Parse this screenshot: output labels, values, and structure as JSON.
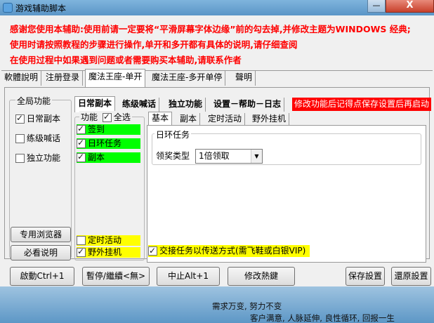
{
  "window": {
    "title": "游戏辅助脚本",
    "minimize_glyph": "—",
    "close_glyph": "X"
  },
  "notices": [
    "感谢您使用本辅助:使用前请一定要将“平滑屏幕字体边缘”前的勾去掉,并修改主题为WINDOWS 经典;",
    "使用时请按照教程的步骤进行操作,单开和多开都有具体的说明,请仔细查阅",
    "在使用过程中如果遇到问题或者需要购买本辅助,请联系作者"
  ],
  "top_tabs": [
    {
      "label": "軟體說明",
      "active": false
    },
    {
      "label": "注册登录",
      "active": false
    },
    {
      "label": "魔法王座-单开",
      "active": true
    },
    {
      "label": "魔法王座-多开单停",
      "active": false
    },
    {
      "label": "聲明",
      "active": false
    }
  ],
  "global_group": {
    "title": "全局功能",
    "items": [
      {
        "label": "日常副本",
        "checked": true
      },
      {
        "label": "练级喊话",
        "checked": false
      },
      {
        "label": "独立功能",
        "checked": false
      }
    ],
    "browser_button": "专用浏览器",
    "help_button": "必看说明"
  },
  "sub_tabs": [
    {
      "label": "日常副本",
      "active": true
    },
    {
      "label": "练级喊话",
      "active": false
    },
    {
      "label": "独立功能",
      "active": false
    },
    {
      "label": "设置－帮助－日志",
      "active": false
    }
  ],
  "red_banner": "修改功能后记得点保存设置后再启动",
  "func_group": {
    "title": "功能",
    "select_all_label": "全选",
    "select_all_checked": true,
    "items": [
      {
        "label": "签到",
        "checked": true,
        "color": "#00ff00"
      },
      {
        "label": "日环任务",
        "checked": true,
        "color": "#00ff00"
      },
      {
        "label": "副本",
        "checked": true,
        "color": "#00ff00"
      },
      {
        "label": "定时活动",
        "checked": false,
        "color": "#ffff00"
      },
      {
        "label": "野外挂机",
        "checked": true,
        "color": "#ffff00"
      }
    ]
  },
  "inner_tabs": [
    {
      "label": "基本",
      "active": true
    },
    {
      "label": "副本",
      "active": false
    },
    {
      "label": "定时活动",
      "active": false
    },
    {
      "label": "野外挂机",
      "active": false
    }
  ],
  "daily_ring": {
    "group_title": "日环任务",
    "reward_label": "领奖类型",
    "reward_value": "1倍领取"
  },
  "relay_option": {
    "label": "交接任务以传送方式(需飞鞋或白银VIP)",
    "checked": true
  },
  "bottom_buttons": {
    "start": "啟動Ctrl+1",
    "pause": "暫停/繼續<無>",
    "stop": "中止Alt+1",
    "hotkey": "修改熱鍵",
    "save": "保存設置",
    "restore": "還原設置"
  },
  "footer": {
    "line1": "需求万变, 努力不变",
    "line2": "客户满意, 人脉延伸, 良性循环, 回报一生"
  }
}
